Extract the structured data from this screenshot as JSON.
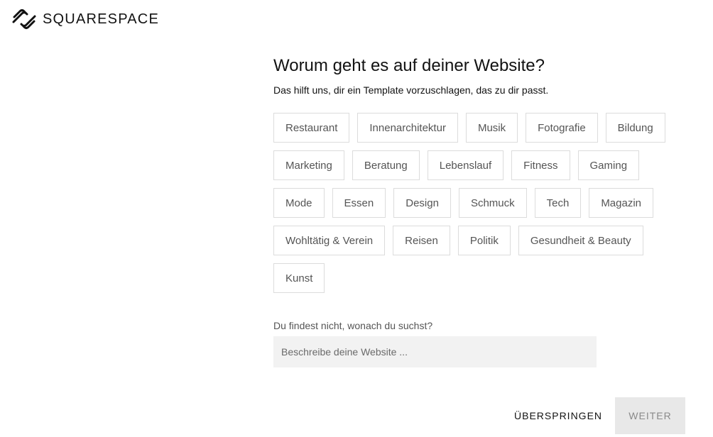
{
  "brand": {
    "name": "SQUARESPACE",
    "logo_icon": "squarespace-logo-icon"
  },
  "header": {
    "title": "Worum geht es auf deiner Website?",
    "subtitle": "Das hilft uns, dir ein Template vorzuschlagen, das zu dir passt."
  },
  "categories": {
    "rows": [
      [
        "Restaurant",
        "Innenarchitektur",
        "Musik",
        "Fotografie",
        "Bildung"
      ],
      [
        "Marketing",
        "Beratung",
        "Lebenslauf",
        "Fitness",
        "Gaming"
      ],
      [
        "Mode",
        "Essen",
        "Design",
        "Schmuck",
        "Tech",
        "Magazin"
      ],
      [
        "Wohltätig & Verein",
        "Reisen",
        "Politik",
        "Gesundheit & Beauty"
      ],
      [
        "Kunst"
      ]
    ]
  },
  "custom": {
    "prompt": "Du findest nicht, wonach du suchst?",
    "placeholder": "Beschreibe deine Website ...",
    "value": ""
  },
  "footer": {
    "skip_label": "ÜBERSPRINGEN",
    "next_label": "WEITER"
  }
}
